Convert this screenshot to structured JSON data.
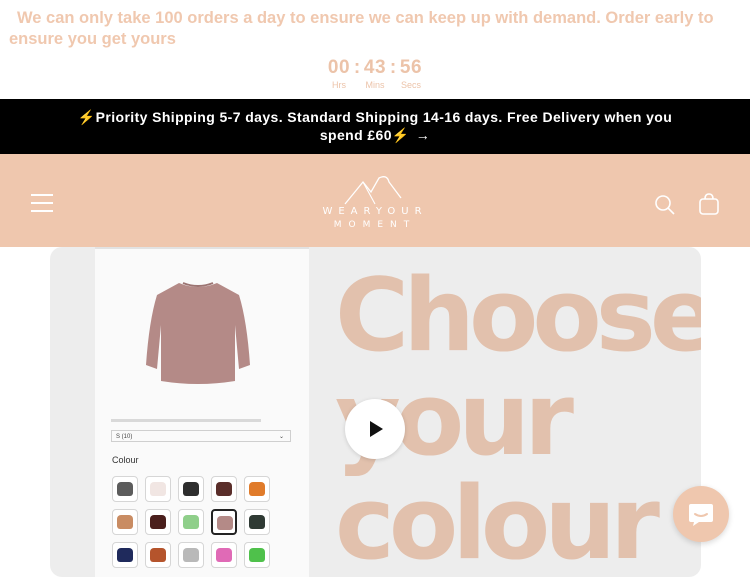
{
  "promo": {
    "text": "We can only take 100 orders a day to ensure we can keep up with demand. Order early to ensure you get yours"
  },
  "timer": {
    "hours": "00",
    "minutes": "43",
    "seconds": "56",
    "separator": ":",
    "hours_label": "Hrs",
    "minutes_label": "Mins",
    "seconds_label": "Secs"
  },
  "shipping_bar": {
    "text": "⚡Priority Shipping 5-7 days. Standard Shipping 14-16 days. Free Delivery when you spend £60⚡",
    "arrow": "→"
  },
  "header": {
    "logo_line1": "WEARYOUR",
    "logo_line2": "MOMENT",
    "menu_icon": "hamburger-icon",
    "search_icon": "search-icon",
    "cart_icon": "cart-icon"
  },
  "media": {
    "headline": [
      "Choose",
      "your",
      "colour"
    ],
    "size_select_value": "S (10)",
    "colour_label": "Colour",
    "play_icon": "play-icon",
    "swatch_colors": [
      [
        "#5c5c5c",
        "#f1e6e3",
        "#2e2e2e",
        "#5a2e2a",
        "#e07b2a"
      ],
      [
        "#c98c63",
        "#4a1f1c",
        "#8fcf8a",
        "#b48a87",
        "#2f3a34"
      ],
      [
        "#1f2a5c",
        "#b5542c",
        "#b9b9b9",
        "#e06ab6",
        "#4fc14b"
      ]
    ],
    "selected_swatch": "row-2-col-4",
    "sweater_color": "#b48a87"
  },
  "chat": {
    "icon": "chat-icon",
    "color": "#efc7ae"
  }
}
